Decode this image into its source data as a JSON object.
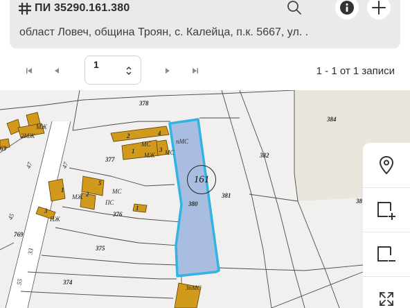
{
  "header": {
    "title": "ПИ 35290.161.380",
    "address": "област Ловеч, община Троян, с. Калейца, п.к. 5667, ул. ."
  },
  "pagination": {
    "current_page": "1",
    "records_text": "1 - 1 от 1 записи"
  },
  "map": {
    "highlight_color": "#2fb4e3",
    "highlight_fill": "#a9bde0",
    "building_color": "#d29a1d",
    "parcel_id": "161",
    "labels": {
      "p378": "378",
      "p384": "384",
      "p382": "382",
      "p381": "381",
      "p380": "380",
      "p377": "377",
      "p376": "376",
      "p375": "375",
      "p374": "374",
      "p769": "769",
      "p63": "63",
      "p38": "38",
      "n47a": "47",
      "n47b": "47",
      "n45": "45",
      "n33": "33",
      "n55": "55",
      "mzh1": "2МЖ",
      "mzh_small": "МЖ",
      "b2": "2",
      "b4": "4",
      "b3": "3",
      "b1": "1",
      "b5": "5",
      "b2b": "2",
      "b1b": "1",
      "b3b": "3",
      "b1c": "1",
      "ms1": "МС",
      "pms1": "пМС",
      "mzh2": "МЖ",
      "ms2": "МС",
      "mzh3": "МЖ",
      "ms3": "МС",
      "ps1": "ПС",
      "pzh1": "ПЖ",
      "bottom_bld": "3пМС"
    }
  }
}
